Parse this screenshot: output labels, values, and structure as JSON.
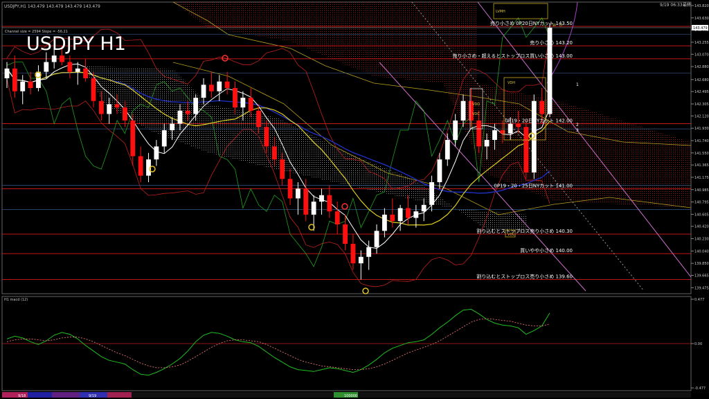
{
  "header": {
    "symbol_info": "USDJPY,H1  143.479 143.479 143.479 143.479",
    "timestamp": "9/19 06:33",
    "status": "最終"
  },
  "chart_title": "USDJPY H1",
  "indicator_legend": "Channel size = 2594 Slope = -56.21",
  "chart_data": [
    {
      "type": "candlestick",
      "title": "USDJPY H1",
      "ylim": [
        139.425,
        143.82
      ],
      "y_ticks": [
        {
          "label": "143.820",
          "v": 143.82
        },
        {
          "label": "143.630",
          "v": 143.63
        },
        {
          "label": "143.445",
          "v": 143.445
        },
        {
          "label": "143.255",
          "v": 143.255
        },
        {
          "label": "143.070",
          "v": 143.07
        },
        {
          "label": "142.880",
          "v": 142.88
        },
        {
          "label": "142.680",
          "v": 142.68
        },
        {
          "label": "142.495",
          "v": 142.495
        },
        {
          "label": "142.305",
          "v": 142.305
        },
        {
          "label": "142.120",
          "v": 142.12
        },
        {
          "label": "141.930",
          "v": 141.93
        },
        {
          "label": "141.740",
          "v": 141.74
        },
        {
          "label": "141.550",
          "v": 141.55
        },
        {
          "label": "141.365",
          "v": 141.365
        },
        {
          "label": "141.175",
          "v": 141.175
        },
        {
          "label": "140.985",
          "v": 140.985
        },
        {
          "label": "140.795",
          "v": 140.795
        },
        {
          "label": "140.605",
          "v": 140.605
        },
        {
          "label": "140.420",
          "v": 140.42
        },
        {
          "label": "140.230",
          "v": 140.23
        },
        {
          "label": "140.040",
          "v": 140.04
        },
        {
          "label": "139.850",
          "v": 139.85
        },
        {
          "label": "139.665",
          "v": 139.665
        },
        {
          "label": "139.475",
          "v": 139.475
        }
      ],
      "current_price": {
        "label": "143.479",
        "v": 143.479
      },
      "levels": [
        {
          "v": 143.5,
          "label": "売り小さめ 0P20日NYカット 143.50",
          "color": "#ff2020"
        },
        {
          "v": 143.2,
          "label": "売り小さめ 143.20",
          "color": "#ff2020"
        },
        {
          "v": 143.0,
          "label": "売り小さめ・超えるとストップロス買い小さめ 143.00",
          "color": "#ff2020"
        },
        {
          "v": 142.0,
          "label": "0P19・20日NYカット 142.00",
          "color": "#ff2020"
        },
        {
          "v": 141.0,
          "label": "0P19・20・25日NYカット 141.00",
          "color": "#ff2020"
        },
        {
          "v": 140.3,
          "label": "割り込むとストップロス売り小さめ 140.30",
          "color": "#ff2020"
        },
        {
          "v": 140.0,
          "label": "買いやや小さめ 140.00",
          "color": "#ff2020"
        },
        {
          "v": 139.6,
          "label": "割り込むとストップロス売り小さめ 139.60",
          "color": "#ff2020"
        }
      ],
      "box_labels": [
        "LVMH",
        "VDH",
        "VDO",
        "VDC",
        "VDL",
        "W",
        "D"
      ],
      "channel_labels": [
        "1",
        "2",
        "3"
      ],
      "candles": [
        [
          142.7,
          142.95,
          142.55,
          142.85
        ],
        [
          142.85,
          143.05,
          142.4,
          142.5
        ],
        [
          142.5,
          142.75,
          142.3,
          142.65
        ],
        [
          142.65,
          142.8,
          142.45,
          142.55
        ],
        [
          142.55,
          142.9,
          142.5,
          142.8
        ],
        [
          142.8,
          143.1,
          142.7,
          142.95
        ],
        [
          142.95,
          143.15,
          142.85,
          143.05
        ],
        [
          143.05,
          143.2,
          142.9,
          142.95
        ],
        [
          142.95,
          143.05,
          142.7,
          142.8
        ],
        [
          142.8,
          142.95,
          142.6,
          142.85
        ],
        [
          142.85,
          143.0,
          142.65,
          142.7
        ],
        [
          142.7,
          142.8,
          142.25,
          142.35
        ],
        [
          142.35,
          142.5,
          142.05,
          142.15
        ],
        [
          142.15,
          142.4,
          142.0,
          142.3
        ],
        [
          142.3,
          142.45,
          142.15,
          142.25
        ],
        [
          142.25,
          142.35,
          141.95,
          142.05
        ],
        [
          142.05,
          142.15,
          141.35,
          141.5
        ],
        [
          141.5,
          141.65,
          141.1,
          141.2
        ],
        [
          141.2,
          141.55,
          141.1,
          141.45
        ],
        [
          141.45,
          141.75,
          141.35,
          141.65
        ],
        [
          141.65,
          142.0,
          141.55,
          141.9
        ],
        [
          141.9,
          142.1,
          141.75,
          142.0
        ],
        [
          142.0,
          142.3,
          141.9,
          142.2
        ],
        [
          142.2,
          142.35,
          142.05,
          142.15
        ],
        [
          142.15,
          142.45,
          142.05,
          142.4
        ],
        [
          142.4,
          142.7,
          142.3,
          142.6
        ],
        [
          142.6,
          142.8,
          142.4,
          142.5
        ],
        [
          142.5,
          142.75,
          142.35,
          142.65
        ],
        [
          142.65,
          142.8,
          142.45,
          142.55
        ],
        [
          142.55,
          142.65,
          142.15,
          142.25
        ],
        [
          142.25,
          142.5,
          142.05,
          142.4
        ],
        [
          142.4,
          142.55,
          142.1,
          142.2
        ],
        [
          142.2,
          142.3,
          141.85,
          141.95
        ],
        [
          141.95,
          142.05,
          141.55,
          141.65
        ],
        [
          141.65,
          141.8,
          141.35,
          141.45
        ],
        [
          141.45,
          141.55,
          141.05,
          141.15
        ],
        [
          141.15,
          141.3,
          140.75,
          140.85
        ],
        [
          140.85,
          141.1,
          140.6,
          141.0
        ],
        [
          141.0,
          141.15,
          140.5,
          140.6
        ],
        [
          140.6,
          140.9,
          140.35,
          140.8
        ],
        [
          140.8,
          141.0,
          140.6,
          140.9
        ],
        [
          140.9,
          141.05,
          140.55,
          140.65
        ],
        [
          140.65,
          140.8,
          140.3,
          140.45
        ],
        [
          140.45,
          140.6,
          140.05,
          140.15
        ],
        [
          140.15,
          140.3,
          139.75,
          139.85
        ],
        [
          139.85,
          140.05,
          139.6,
          139.95
        ],
        [
          139.95,
          140.2,
          139.75,
          140.1
        ],
        [
          140.1,
          140.45,
          140.0,
          140.35
        ],
        [
          140.35,
          140.7,
          140.25,
          140.6
        ],
        [
          140.6,
          140.85,
          140.4,
          140.5
        ],
        [
          140.5,
          140.75,
          140.35,
          140.7
        ],
        [
          140.7,
          140.9,
          140.45,
          140.55
        ],
        [
          140.55,
          140.75,
          140.4,
          140.65
        ],
        [
          140.65,
          140.85,
          140.5,
          140.75
        ],
        [
          140.75,
          141.2,
          140.65,
          141.1
        ],
        [
          141.1,
          141.55,
          141.0,
          141.45
        ],
        [
          141.45,
          141.85,
          141.35,
          141.75
        ],
        [
          141.75,
          142.15,
          141.65,
          142.05
        ],
        [
          142.05,
          142.45,
          141.95,
          142.35
        ],
        [
          142.35,
          142.55,
          141.95,
          142.05
        ],
        [
          142.05,
          142.2,
          141.55,
          141.65
        ],
        [
          141.65,
          141.85,
          141.45,
          141.75
        ],
        [
          141.75,
          142.0,
          141.6,
          141.9
        ],
        [
          141.9,
          142.05,
          141.7,
          141.85
        ],
        [
          141.85,
          142.1,
          141.75,
          142.0
        ],
        [
          142.0,
          142.2,
          141.85,
          141.95
        ],
        [
          141.95,
          142.05,
          141.15,
          141.25
        ],
        [
          141.25,
          142.45,
          141.15,
          142.35
        ],
        [
          142.35,
          142.55,
          142.0,
          142.15
        ],
        [
          142.15,
          143.55,
          142.1,
          143.48
        ]
      ]
    },
    {
      "type": "line",
      "title": "H1  macd (12)",
      "ylim": [
        -0.477,
        0.477
      ],
      "y_ticks": [
        {
          "label": "0.477",
          "v": 0.477
        },
        {
          "label": "0.00",
          "v": 0.0
        },
        {
          "label": "-0.477",
          "v": -0.477
        }
      ],
      "series": [
        {
          "color": "#20c020",
          "values": [
            0.05,
            0.08,
            0.06,
            0.02,
            -0.01,
            0.03,
            0.09,
            0.12,
            0.1,
            0.05,
            -0.02,
            -0.08,
            -0.14,
            -0.18,
            -0.2,
            -0.22,
            -0.28,
            -0.33,
            -0.34,
            -0.31,
            -0.27,
            -0.22,
            -0.16,
            -0.08,
            0.02,
            0.09,
            0.12,
            0.11,
            0.08,
            0.04,
            0.02,
            0.01,
            -0.03,
            -0.09,
            -0.15,
            -0.2,
            -0.25,
            -0.28,
            -0.29,
            -0.3,
            -0.28,
            -0.26,
            -0.27,
            -0.29,
            -0.31,
            -0.28,
            -0.23,
            -0.17,
            -0.1,
            -0.05,
            -0.02,
            0.01,
            0.02,
            0.04,
            0.1,
            0.17,
            0.23,
            0.3,
            0.36,
            0.37,
            0.32,
            0.26,
            0.22,
            0.2,
            0.19,
            0.17,
            0.1,
            0.14,
            0.19,
            0.33
          ]
        },
        {
          "color": "#ff8080",
          "values": [
            0.02,
            0.04,
            0.05,
            0.05,
            0.04,
            0.03,
            0.04,
            0.06,
            0.07,
            0.07,
            0.05,
            0.02,
            -0.02,
            -0.06,
            -0.1,
            -0.13,
            -0.17,
            -0.21,
            -0.24,
            -0.26,
            -0.26,
            -0.25,
            -0.23,
            -0.19,
            -0.14,
            -0.09,
            -0.04,
            0.0,
            0.03,
            0.04,
            0.04,
            0.03,
            0.02,
            -0.01,
            -0.05,
            -0.09,
            -0.13,
            -0.17,
            -0.2,
            -0.22,
            -0.24,
            -0.25,
            -0.26,
            -0.27,
            -0.28,
            -0.28,
            -0.27,
            -0.25,
            -0.22,
            -0.18,
            -0.14,
            -0.1,
            -0.07,
            -0.04,
            -0.01,
            0.03,
            0.08,
            0.13,
            0.18,
            0.23,
            0.26,
            0.27,
            0.26,
            0.25,
            0.24,
            0.22,
            0.2,
            0.19,
            0.19,
            0.21
          ]
        }
      ]
    }
  ],
  "time_axis": {
    "dates": [
      "9/18",
      "9/19"
    ],
    "footer_code": "100000"
  }
}
